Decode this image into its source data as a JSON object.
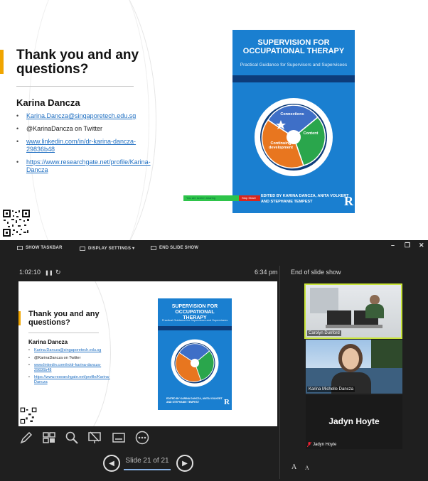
{
  "slide": {
    "title": "Thank you and any questions?",
    "presenter_name": "Karina Dancza",
    "contacts": [
      {
        "text": "Karina.Dancza@singaporetech.edu.sg",
        "link": true
      },
      {
        "text": "@KarinaDancza on Twitter",
        "link": false
      },
      {
        "text": "www.linkedin.com/in/dr-karina-dancza-29836b48",
        "link": true
      },
      {
        "text": "https://www.researchgate.net/profile/Karina-Dancza",
        "link": true
      }
    ],
    "book": {
      "title": "SUPERVISION FOR OCCUPATIONAL THERAPY",
      "subtitle": "Practical Guidance for Supervisors and Supervisees",
      "segments": [
        "Connections",
        "Content",
        "Continuing development"
      ],
      "authors": "EDITED BY KARINA DANCZA, ANITA VOLKERT AND STEPHANIE TEMPEST",
      "publisher_logo": "R"
    },
    "share_bar": {
      "sharing_text": "You are screen sharing",
      "stop_text": "Stop Share"
    }
  },
  "toolbar": {
    "show_taskbar": "SHOW TASKBAR",
    "display_settings": "DISPLAY SETTINGS ▾",
    "end_slide_show": "END SLIDE SHOW",
    "minimize": "–",
    "restore": "❐",
    "close": "✕"
  },
  "presenter": {
    "timer": "1:02:10",
    "pause_icon": "❚❚",
    "reset_icon": "↻",
    "clock": "6:34 pm",
    "next_slide_label": "End of slide show",
    "slide_counter": "Slide 21 of 21",
    "prev_icon": "◀",
    "next_icon": "▶",
    "font_increase": "A",
    "font_decrease": "A",
    "tools": [
      "pen-icon",
      "slides-grid-icon",
      "magnifier-icon",
      "pointer-screen-icon",
      "subtitles-icon",
      "more-options-icon"
    ]
  },
  "participants": [
    {
      "name": "Carolyn Dunford"
    },
    {
      "name": "Karina Michelle Dancza"
    },
    {
      "name": "Jadyn Hoyte",
      "muted": true
    }
  ],
  "colors": {
    "accent_bar": "#f0a500",
    "book_blue": "#1a7fd0",
    "active_speaker_border": "#c9e53a"
  }
}
